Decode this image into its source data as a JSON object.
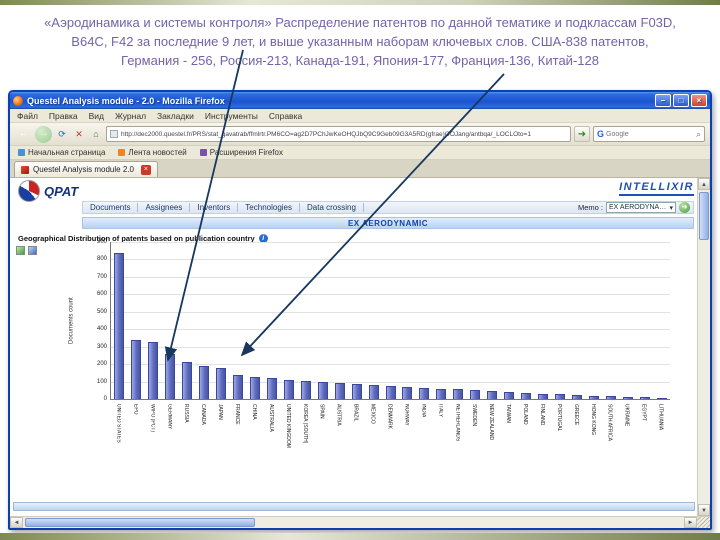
{
  "slide": {
    "headline": {
      "line1": "«Аэродинамика и системы контроля» Распределение патентов по  данной тематике и подклассам F03D,",
      "line2": "B64C, F42 за последние 9 лет,  и  выше указанным наборам ключевых слов. США-838 патентов,",
      "line3": "Германия - 256, Россия-213, Канада-191, Япония-177, Франция-136, Китай-128"
    }
  },
  "browser": {
    "window_title": "Questel Analysis module - 2.0 - Mozilla Firefox",
    "window_buttons": {
      "minimize": "–",
      "maximize": "□",
      "close": "×"
    },
    "menu_items": [
      "Файл",
      "Правка",
      "Вид",
      "Журнал",
      "Закладки",
      "Инструменты",
      "Справка"
    ],
    "toolbar_icons": {
      "back": "←",
      "forward": "→",
      "reload": "⟳",
      "stop": "✕",
      "home": "⌂",
      "go": "➜",
      "magnifier": "⌕",
      "engine": "G"
    },
    "url": "http://dec2000.questel.fr/PRS/stat_gavatrab/ffmlrtr.PM6CO=ag2D7PChJwKeOHQJbQ9C9Geb09G3A5RD(gfrae)OOJang/antbqa/_LOCLOto=1",
    "search_placeholder": "Google",
    "bookmarks": [
      "Начальная страница",
      "Лента новостей",
      "Расширения Firefox"
    ],
    "tab_title": "Questel Analysis module 2.0",
    "scrollbar_icons": {
      "up": "▲",
      "down": "▼",
      "left": "◄",
      "right": "►"
    }
  },
  "app": {
    "logo_text": "QPAT",
    "brand": "INTELLIXIR",
    "nav_items": [
      "Documents",
      "Assignees",
      "Inventors",
      "Technologies",
      "Data crossing"
    ],
    "memo_label": "Memo :",
    "memo_value": "EX AERODYNAMIC",
    "banner": "EX AERODYNAMIC",
    "section_title": "Geographical Distribution of patents based on publication country",
    "info_glyph": "i"
  },
  "chart_data": {
    "type": "bar",
    "title": "Geographical Distribution of patents based on publication country",
    "xlabel": "",
    "ylabel": "Documents count",
    "ylim": [
      0,
      900
    ],
    "ytick_step": 100,
    "grid": true,
    "legend": false,
    "bar_color": "#5f6cc0",
    "categories": [
      "UNITED STATES",
      "EPO",
      "WIPO (PCT)",
      "GERMANY",
      "RUSSIA",
      "CANADA",
      "JAPAN",
      "FRANCE",
      "CHINA",
      "AUSTRALIA",
      "UNITED KINGDOM",
      "KOREA (SOUTH)",
      "SPAIN",
      "AUSTRIA",
      "BRAZIL",
      "MEXICO",
      "DENMARK",
      "NORWAY",
      "INDIA",
      "ITALY",
      "NETHERLANDS",
      "SWEDEN",
      "NEW ZEALAND",
      "TAIWAN",
      "POLAND",
      "FINLAND",
      "PORTUGAL",
      "GREECE",
      "HONG KONG",
      "SOUTH AFRICA",
      "UKRAINE",
      "EGYPT",
      "LITHUANIA"
    ],
    "values": [
      838,
      340,
      328,
      256,
      213,
      191,
      177,
      136,
      128,
      118,
      110,
      103,
      97,
      91,
      86,
      81,
      76,
      71,
      66,
      60,
      55,
      50,
      45,
      40,
      35,
      30,
      26,
      22,
      18,
      15,
      12,
      9,
      6
    ]
  },
  "annotation": {
    "arrow_color": "#17375e"
  }
}
